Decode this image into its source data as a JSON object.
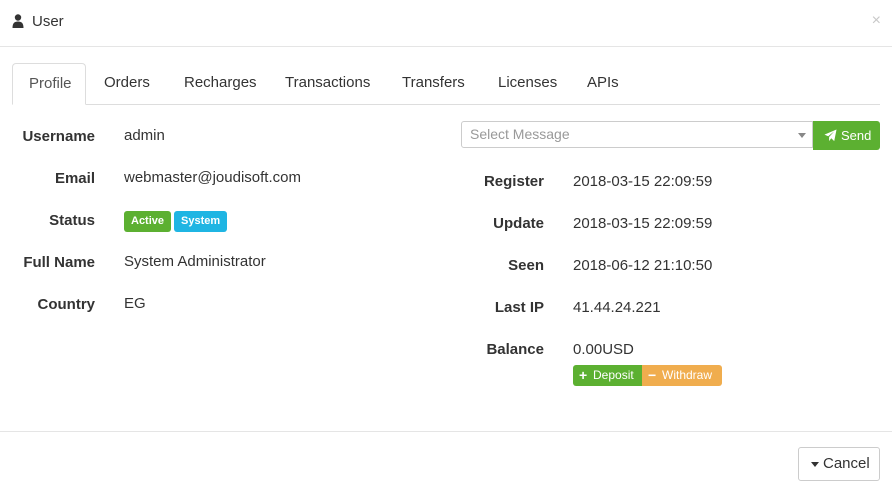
{
  "dialog": {
    "title": "User",
    "close_glyph": "×"
  },
  "tabs": [
    {
      "label": "Profile",
      "active": true
    },
    {
      "label": "Orders"
    },
    {
      "label": "Recharges"
    },
    {
      "label": "Transactions"
    },
    {
      "label": "Transfers"
    },
    {
      "label": "Licenses"
    },
    {
      "label": "APIs"
    }
  ],
  "profile_left": {
    "username": {
      "label": "Username",
      "value": "admin"
    },
    "email": {
      "label": "Email",
      "value": "webmaster@joudisoft.com"
    },
    "status": {
      "label": "Status",
      "badges": [
        "Active",
        "System"
      ]
    },
    "full_name": {
      "label": "Full Name",
      "value": "System Administrator"
    },
    "country": {
      "label": "Country",
      "value": "EG"
    }
  },
  "message": {
    "placeholder": "Select Message",
    "send_label": "Send"
  },
  "profile_right": {
    "register": {
      "label": "Register",
      "value": "2018-03-15 22:09:59"
    },
    "update": {
      "label": "Update",
      "value": "2018-03-15 22:09:59"
    },
    "seen": {
      "label": "Seen",
      "value": "2018-06-12 21:10:50"
    },
    "last_ip": {
      "label": "Last IP",
      "value": "41.44.24.221"
    },
    "balance": {
      "label": "Balance",
      "value": "0.00USD"
    }
  },
  "balance_actions": {
    "deposit_label": "Deposit",
    "withdraw_label": "Withdraw"
  },
  "footer": {
    "cancel_label": "Cancel"
  },
  "colors": {
    "success": "#5cb031",
    "info": "#1fb5e3",
    "warning": "#f0ad4e",
    "border": "#dddddd"
  },
  "icons": {
    "title_icon": "user-icon",
    "send_icon": "paper-plane-icon",
    "deposit_icon": "plus-icon",
    "withdraw_icon": "minus-icon",
    "cancel_icon": "caret-down-icon",
    "select_icon": "caret-down-icon"
  }
}
